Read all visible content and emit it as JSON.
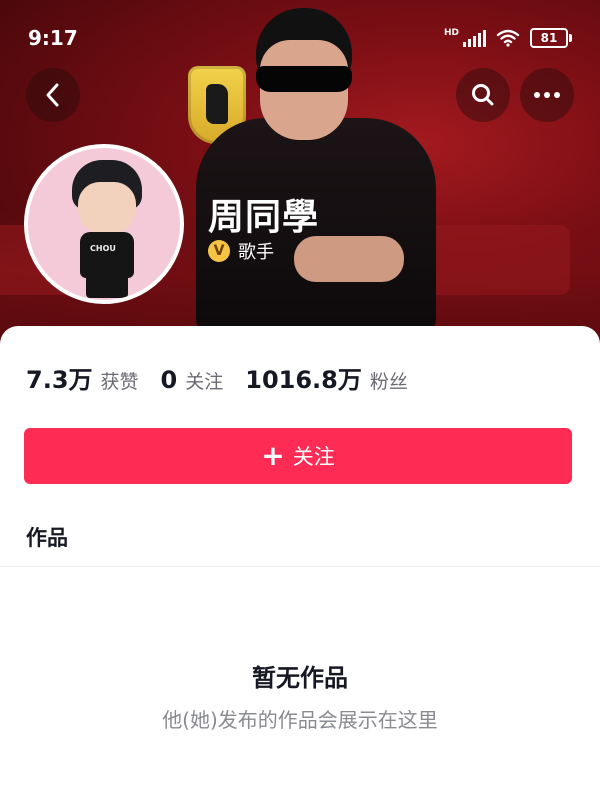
{
  "status_bar": {
    "time": "9:17",
    "network_badge": "HD",
    "battery": "81"
  },
  "header": {
    "back_icon": "chevron-left-icon",
    "search_icon": "search-icon",
    "more_icon": "more-dots-icon"
  },
  "profile": {
    "name": "周同學",
    "badge_letter": "V",
    "verification_label": "歌手",
    "avatar_shirt_text": "CHOU"
  },
  "stats": [
    {
      "value": "7.3万",
      "label": "获赞"
    },
    {
      "value": "0",
      "label": "关注"
    },
    {
      "value": "1016.8万",
      "label": "粉丝"
    }
  ],
  "follow_button": {
    "icon": "+",
    "label": "关注",
    "color": "#fe2c55"
  },
  "tabs": {
    "works": "作品"
  },
  "empty_state": {
    "title": "暂无作品",
    "subtitle": "他(她)发布的作品会展示在这里"
  }
}
